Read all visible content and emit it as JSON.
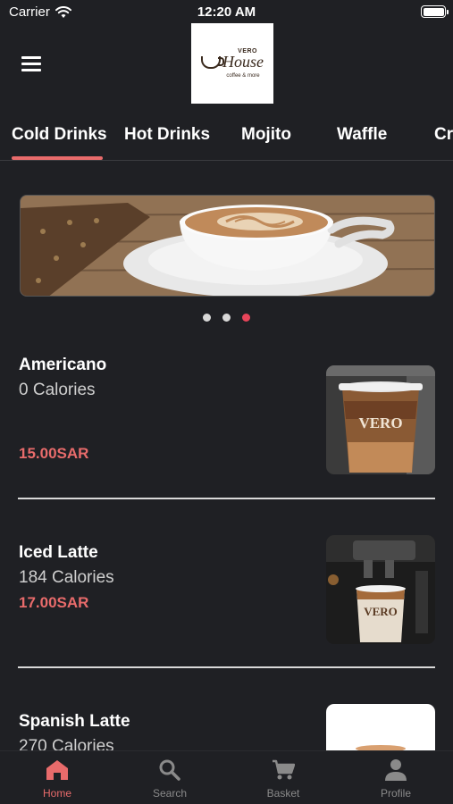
{
  "status_bar": {
    "carrier": "Carrier",
    "time": "12:20 AM"
  },
  "logo": {
    "top": "VERO",
    "brand": "House",
    "tagline": "coffee & more"
  },
  "tabs": [
    {
      "label": "Cold Drinks",
      "active": true
    },
    {
      "label": "Hot Drinks",
      "active": false
    },
    {
      "label": "Mojito",
      "active": false
    },
    {
      "label": "Waffle",
      "active": false
    },
    {
      "label": "Cr",
      "active": false
    }
  ],
  "carousel": {
    "count": 3,
    "active_index": 2
  },
  "products": [
    {
      "name": "Americano",
      "calories": "0 Calories",
      "price": "15.00SAR",
      "cup_label": "VERO"
    },
    {
      "name": "Iced Latte",
      "calories": "184 Calories",
      "price": "17.00SAR",
      "cup_label": "VERO"
    },
    {
      "name": "Spanish Latte",
      "calories": "270 Calories",
      "price": ""
    }
  ],
  "bottom_nav": [
    {
      "label": "Home",
      "icon": "home-icon",
      "active": true
    },
    {
      "label": "Search",
      "icon": "search-icon",
      "active": false
    },
    {
      "label": "Basket",
      "icon": "cart-icon",
      "active": false
    },
    {
      "label": "Profile",
      "icon": "person-icon",
      "active": false
    }
  ],
  "colors": {
    "background": "#1f2024",
    "accent": "#e86b6b",
    "dot_active": "#e8455a"
  }
}
